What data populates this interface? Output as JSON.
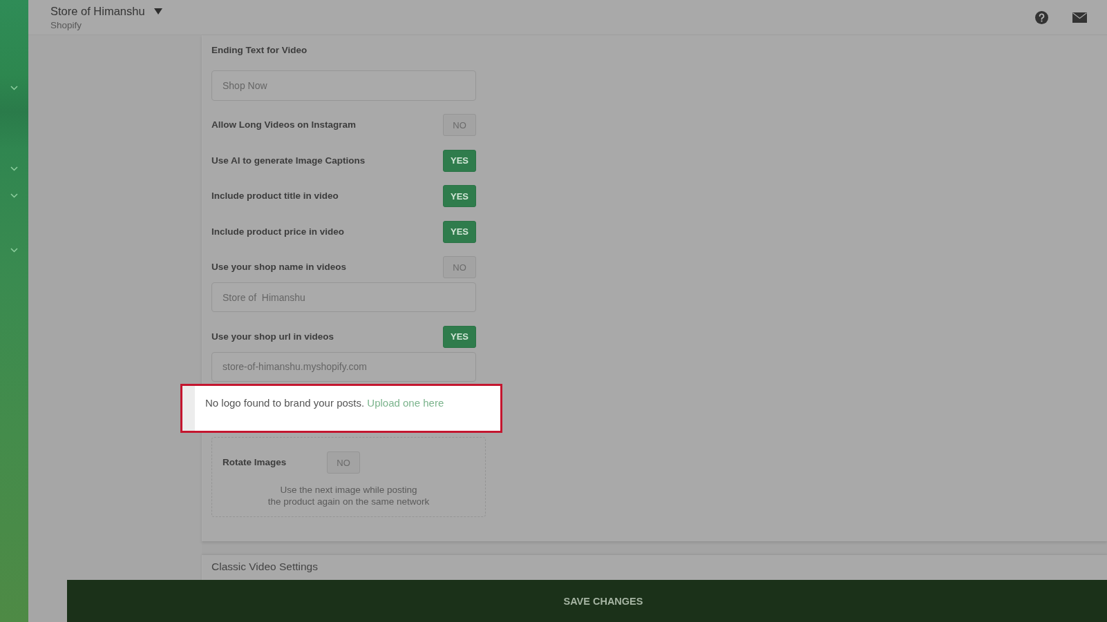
{
  "header": {
    "store_name": "Store of Himanshu",
    "platform": "Shopify"
  },
  "settings": [
    {
      "kind": "text",
      "label": "Ending Text for Video",
      "value": "Shop Now"
    },
    {
      "kind": "toggle",
      "label": "Allow Long Videos on Instagram",
      "on": false,
      "state_text": "NO"
    },
    {
      "kind": "toggle",
      "label": "Use AI to generate Image Captions",
      "on": true,
      "state_text": "YES"
    },
    {
      "kind": "toggle",
      "label": "Include product title in video",
      "on": true,
      "state_text": "YES"
    },
    {
      "kind": "toggle",
      "label": "Include product price in video",
      "on": true,
      "state_text": "YES"
    },
    {
      "kind": "toggle",
      "label": "Use your shop name in videos",
      "on": false,
      "state_text": "NO"
    },
    {
      "kind": "input",
      "value": "Store of  Himanshu"
    },
    {
      "kind": "toggle",
      "label": "Use your shop url in videos",
      "on": true,
      "state_text": "YES"
    },
    {
      "kind": "input",
      "value": "store-of-himanshu.myshopify.com"
    }
  ],
  "notice": {
    "text": "No logo found to brand your posts.",
    "link": "Upload one here"
  },
  "rotate_images": {
    "label": "Rotate Images",
    "on": false,
    "state_text": "NO",
    "description": [
      "Use the next image while posting",
      "the product again on the same network"
    ]
  },
  "next_section": {
    "title": "Classic Video Settings"
  },
  "save_button": {
    "label": "SAVE CHANGES"
  }
}
